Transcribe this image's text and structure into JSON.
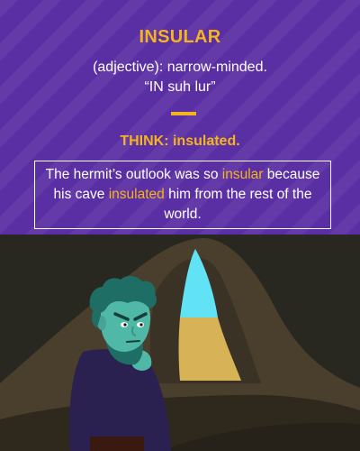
{
  "card": {
    "word": "INSULAR",
    "part_of_speech_definition": "(adjective): narrow-minded.",
    "pronunciation": "“IN suh lur”",
    "think": "THINK: insulated.",
    "sentence": {
      "part1": "The hermit’s outlook was so ",
      "highlight1": "insular",
      "part2": " because his cave ",
      "highlight2": "insulated",
      "part3": " him from the rest of the world."
    }
  },
  "colors": {
    "purple_background": "#5a2fa3",
    "accent_yellow": "#f5b31e",
    "white": "#ffffff",
    "cave_outer": "#282820",
    "cave_rock": "#4a3f2c",
    "sky_blue": "#62e3f5",
    "sand_tan": "#d8b257",
    "skin_teal": "#4fb8a6",
    "hair_dark_teal": "#1f6e66",
    "coat_navy": "#2a2151"
  },
  "icons": [
    "hermit-illustration",
    "cave-illustration"
  ]
}
